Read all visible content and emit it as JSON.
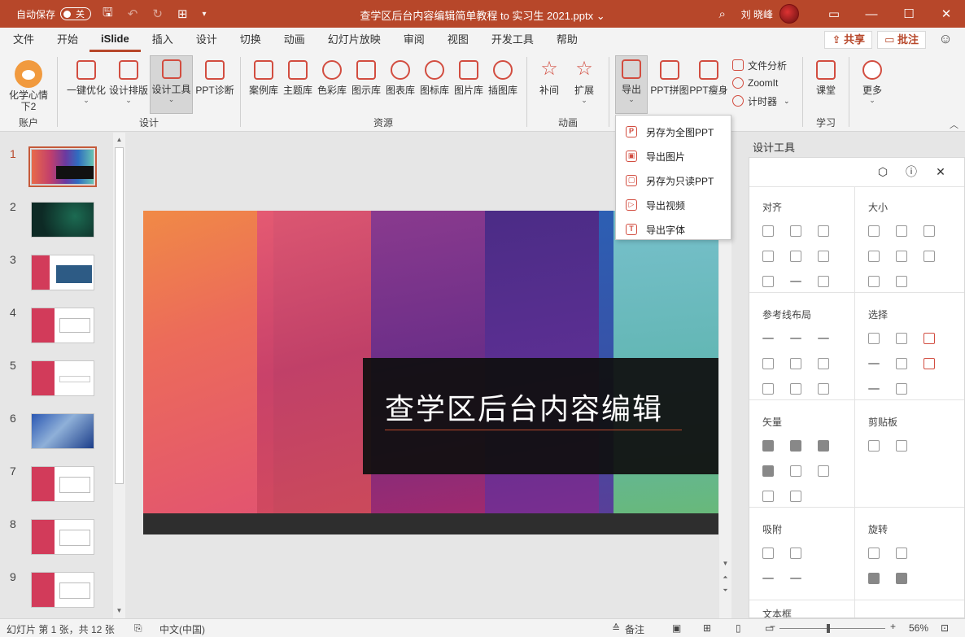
{
  "titlebar": {
    "autosave_label": "自动保存",
    "autosave_state": "关",
    "doc_title": "查学区后台内容编辑简单教程 to 实习生 2021.pptx ⌄",
    "user_name": "刘 晓峰"
  },
  "menu": {
    "tabs": [
      "文件",
      "开始",
      "iSlide",
      "插入",
      "设计",
      "切换",
      "动画",
      "幻灯片放映",
      "审阅",
      "视图",
      "开发工具",
      "帮助"
    ],
    "active": "iSlide",
    "share_label": "共享",
    "comment_label": "批注"
  },
  "ribbon": {
    "account_btn": "化学心情",
    "account_btn2": "下2",
    "group_account": "账户",
    "btn_optimize": "一键优化",
    "btn_layout": "设计排版",
    "btn_design_tools": "设计工具",
    "btn_diagnose": "PPT诊断",
    "group_design": "设计",
    "resources": [
      "案例库",
      "主题库",
      "色彩库",
      "图示库",
      "图表库",
      "图标库",
      "图片库",
      "插图库"
    ],
    "group_resources": "资源",
    "btn_tween": "补间",
    "btn_extend": "扩展",
    "group_animation": "动画",
    "btn_export": "导出",
    "btn_collage": "PPT拼图",
    "btn_slim": "PPT瘦身",
    "btn_file_analysis": "文件分析",
    "btn_zoomit": "ZoomIt",
    "btn_timer": "计时器",
    "btn_classroom": "课堂",
    "group_learn": "学习",
    "btn_more": "更多"
  },
  "export_menu": {
    "items": [
      {
        "label": "另存为全图PPT",
        "icon": "P"
      },
      {
        "label": "导出图片",
        "icon": "▣"
      },
      {
        "label": "另存为只读PPT",
        "icon": "▢"
      },
      {
        "label": "导出视频",
        "icon": "▷"
      },
      {
        "label": "导出字体",
        "icon": "T"
      }
    ]
  },
  "thumbnails": {
    "numbers": [
      "1",
      "2",
      "3",
      "4",
      "5",
      "6",
      "7",
      "8",
      "9"
    ],
    "active_index": 1
  },
  "slide": {
    "title": "查学区后台内容编辑"
  },
  "design_panel": {
    "title": "设计工具",
    "sections": {
      "align": "对齐",
      "size": "大小",
      "guides": "参考线布局",
      "select": "选择",
      "vector": "矢量",
      "clipboard": "剪贴板",
      "snap": "吸附",
      "rotate": "旋转",
      "textbox": "文本框"
    }
  },
  "statusbar": {
    "slide_info": "幻灯片 第 1 张，共 12 张",
    "language": "中文(中国)",
    "notes": "备注",
    "zoom": "56%"
  }
}
